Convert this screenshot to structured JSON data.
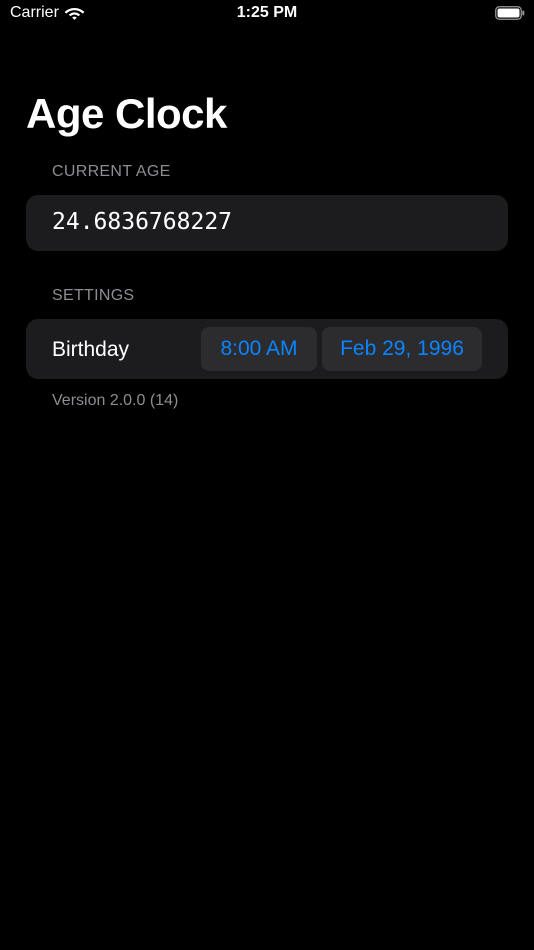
{
  "status_bar": {
    "carrier": "Carrier",
    "time": "1:25 PM",
    "icons": [
      "wifi-icon",
      "battery-icon"
    ]
  },
  "header": {
    "title": "Age Clock"
  },
  "current_age": {
    "section_label": "CURRENT AGE",
    "value": "24.6836768227"
  },
  "settings": {
    "section_label": "SETTINGS",
    "birthday": {
      "label": "Birthday",
      "time": "8:00 AM",
      "date": "Feb 29, 1996"
    }
  },
  "footer": {
    "version": "Version 2.0.0 (14)"
  },
  "colors": {
    "background": "#000000",
    "card": "#1c1c1e",
    "pill": "#2c2c2e",
    "accent": "#0a84ff",
    "secondary_text": "#8d8d93"
  }
}
